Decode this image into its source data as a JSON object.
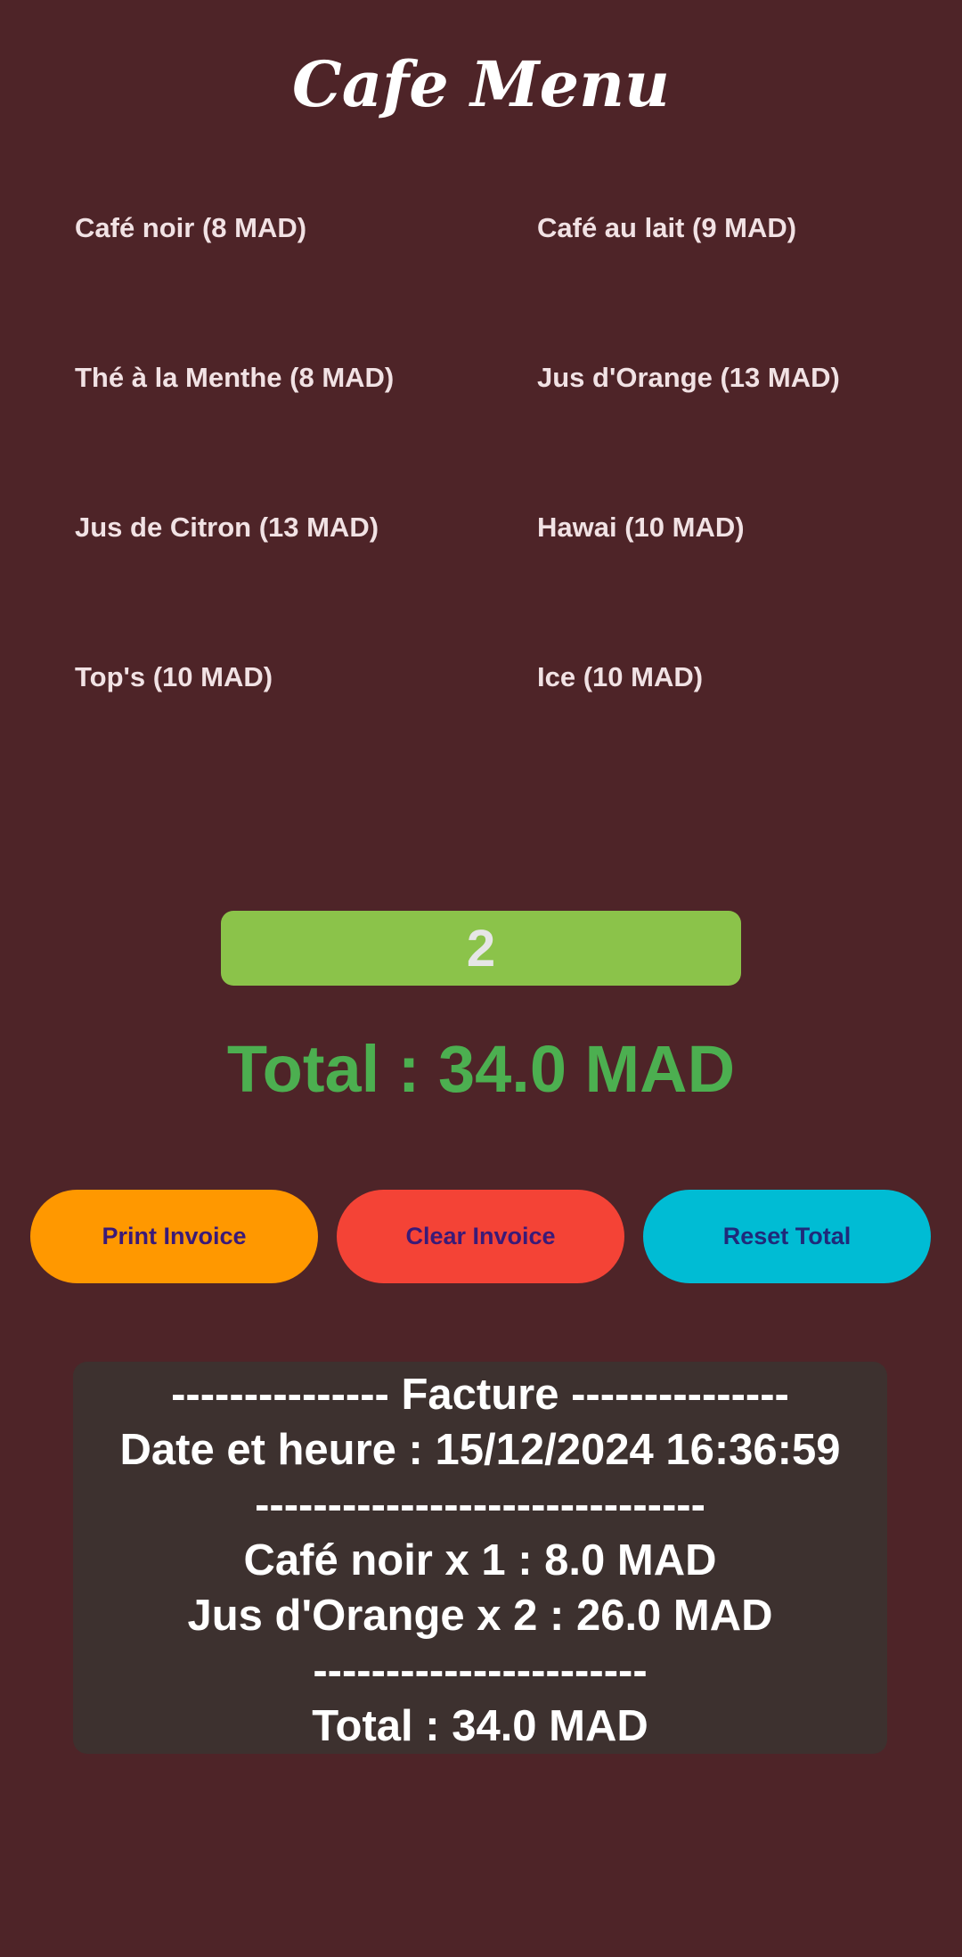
{
  "header": {
    "title": "Cafe Menu"
  },
  "menu": {
    "items": [
      {
        "label": "Café noir (8 MAD)"
      },
      {
        "label": "Café au lait (9 MAD)"
      },
      {
        "label": "Thé à la Menthe (8 MAD)"
      },
      {
        "label": "Jus d'Orange (13 MAD)"
      },
      {
        "label": "Jus de Citron (13 MAD)"
      },
      {
        "label": "Hawai (10 MAD)"
      },
      {
        "label": "Top's (10 MAD)"
      },
      {
        "label": "Ice (10 MAD)"
      }
    ]
  },
  "counter": {
    "value": "2"
  },
  "total": {
    "label": "Total : 34.0 MAD"
  },
  "actions": {
    "print_label": "Print Invoice",
    "clear_label": "Clear Invoice",
    "reset_label": "Reset Total"
  },
  "invoice": {
    "lines": [
      "--------------- Facture ---------------",
      "Date et heure : 15/12/2024 16:36:59",
      "-------------------------------",
      "Café noir x 1 : 8.0 MAD",
      "Jus d'Orange x 2 : 26.0 MAD",
      "-----------------------",
      "Total : 34.0 MAD"
    ]
  },
  "colors": {
    "background": "#4e2428",
    "counter_bg": "#8bc34a",
    "total_text": "#4caf50",
    "print_button": "#ff9800",
    "clear_button": "#f44336",
    "reset_button": "#00bcd4",
    "invoice_bg": "#3d312f"
  }
}
